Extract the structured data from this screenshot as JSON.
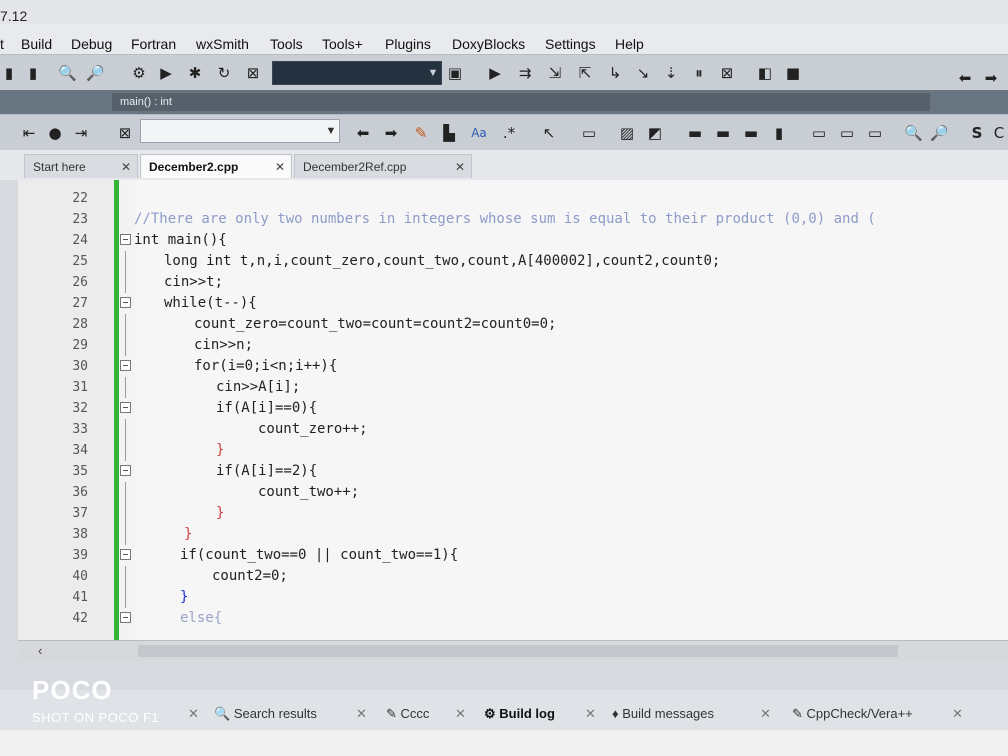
{
  "window": {
    "title_fragment": "7.12"
  },
  "menubar": {
    "items": [
      "t",
      "Build",
      "Debug",
      "Fortran",
      "wxSmith",
      "Tools",
      "Tools+",
      "Plugins",
      "DoxyBlocks",
      "Settings",
      "Help"
    ]
  },
  "scope_bar": {
    "function_scope": "main() : int"
  },
  "tabs": [
    {
      "label": "Start here"
    },
    {
      "label": "December2.cpp",
      "active": true
    },
    {
      "label": "December2Ref.cpp"
    }
  ],
  "editor": {
    "lines": [
      {
        "n": "22",
        "text": ""
      },
      {
        "n": "23",
        "text": "//There are only two numbers in integers whose sum is equal to their product (0,0) and (",
        "type": "comment"
      },
      {
        "n": "24",
        "text": "int main(){"
      },
      {
        "n": "25",
        "text": "long int t,n,i,count_zero,count_two,count,A[400002],count2,count0;"
      },
      {
        "n": "26",
        "text": "cin>>t;"
      },
      {
        "n": "27",
        "text": "while(t--){"
      },
      {
        "n": "28",
        "text": "count_zero=count_two=count=count2=count0=0;"
      },
      {
        "n": "29",
        "text": "cin>>n;"
      },
      {
        "n": "30",
        "text": "for(i=0;i<n;i++){"
      },
      {
        "n": "31",
        "text": "cin>>A[i];"
      },
      {
        "n": "32",
        "text": "if(A[i]==0){"
      },
      {
        "n": "33",
        "text": "count_zero++;"
      },
      {
        "n": "34",
        "text": "}"
      },
      {
        "n": "35",
        "text": "if(A[i]==2){"
      },
      {
        "n": "36",
        "text": "count_two++;"
      },
      {
        "n": "37",
        "text": "}"
      },
      {
        "n": "38",
        "text": "}"
      },
      {
        "n": "39",
        "text": "if(count_two==0 || count_two==1){"
      },
      {
        "n": "40",
        "text": "count2=0;"
      },
      {
        "n": "41",
        "text": "}"
      },
      {
        "n": "42",
        "text": "else{"
      }
    ]
  },
  "bottom_tabs": [
    "Search results",
    "Cccc",
    "Build log",
    "Build messages",
    "CppCheck/Vera++"
  ],
  "watermark": {
    "brand": "POCO",
    "sub": "SHOT ON POCO F1"
  },
  "colors": {
    "change_bar": "#35b535",
    "keyword": "#1b2bd0",
    "comment": "#8d9bc9",
    "literal": "#d04040"
  }
}
